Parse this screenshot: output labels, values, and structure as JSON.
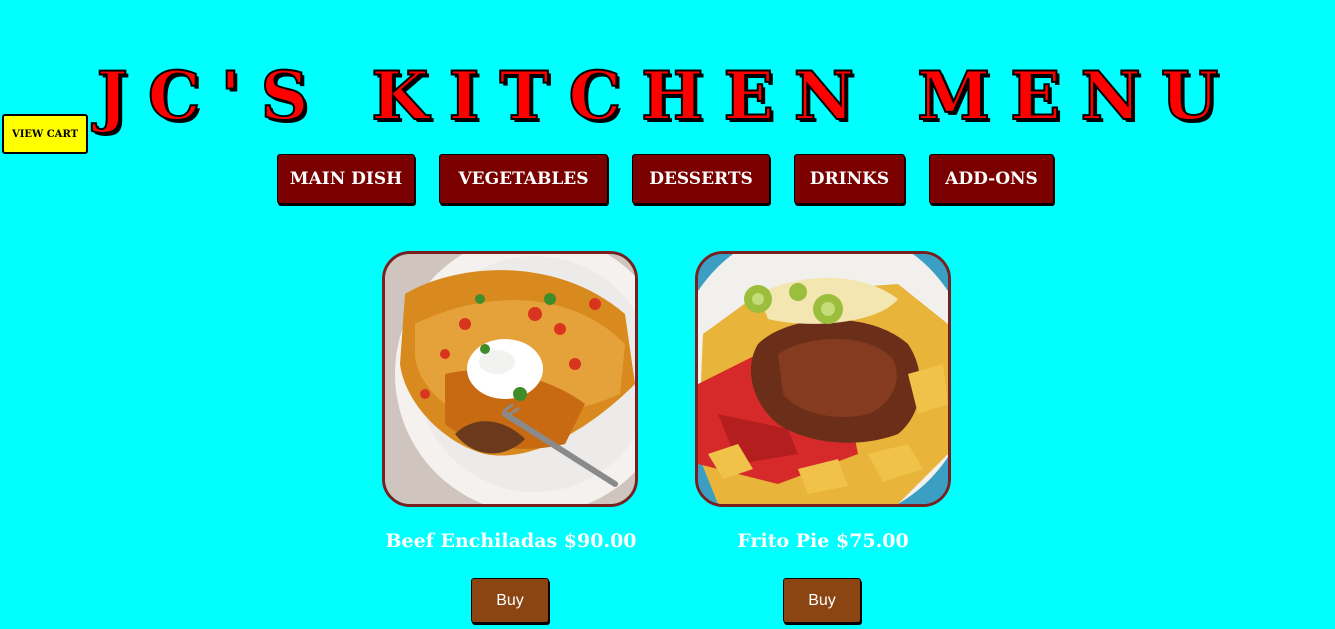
{
  "header": {
    "title": "JC'S KITCHEN MENU"
  },
  "cart": {
    "label": "VIEW CART"
  },
  "categories": [
    {
      "label": "MAIN DISH"
    },
    {
      "label": "VEGETABLES"
    },
    {
      "label": "DESSERTS"
    },
    {
      "label": "DRINKS"
    },
    {
      "label": "ADD-ONS"
    }
  ],
  "items": [
    {
      "label": "Beef Enchiladas $90.00",
      "buy_label": "Buy",
      "image_icon": "beef-enchiladas-photo"
    },
    {
      "label": "Frito Pie $75.00",
      "buy_label": "Buy",
      "image_icon": "frito-pie-photo"
    }
  ],
  "colors": {
    "background": "#00ffff",
    "title": "#ff0000",
    "cart_button": "#ffff00",
    "category_button": "#7a0000",
    "buy_button": "#8b4513",
    "card_border": "#7a1f1f"
  }
}
